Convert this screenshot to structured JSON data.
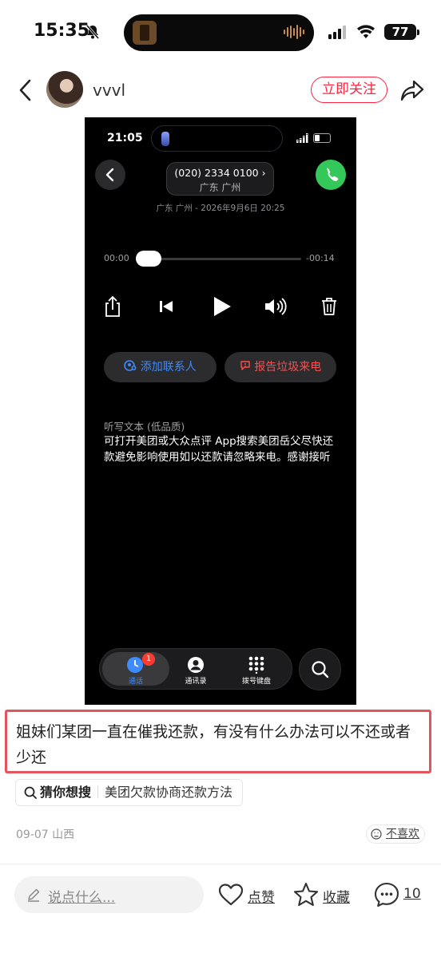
{
  "status_bar": {
    "time": "15:35",
    "battery": "77"
  },
  "header": {
    "username": "vvvl",
    "follow_label": "立即关注"
  },
  "screenshot": {
    "time": "21:05",
    "phone_number": "(020) 2334 0100 ›",
    "location": "广东 广州",
    "date_line": "广东 广州 - 2026年9月6日 20:25",
    "elapsed": "00:00",
    "remaining": "-00:14",
    "add_contact": "添加联系人",
    "report_spam": "报告垃圾来电",
    "transcript_title": "听写文本 (低品质)",
    "transcript_body": "可打开美团或大众点评 App搜索美团岳父尽快还款避免影响使用如以还款请忽略来电。感谢接听",
    "tabs": [
      {
        "label": "通话",
        "badge": "1"
      },
      {
        "label": "通讯录"
      },
      {
        "label": "拨号键盘"
      }
    ],
    "colors": {
      "call_green": "#34c759",
      "accent_blue": "#3d8bfd",
      "report_red": "#ff4d4d"
    }
  },
  "post": {
    "caption": "姐妹们某团一直在催我还款，有没有什么办法可以不还或者少还",
    "search_lead": "猜你想搜",
    "search_suggestion": "美团欠款协商还款方法",
    "date": "09-07",
    "region": "山西",
    "dislike_label": "不喜欢"
  },
  "bottom_bar": {
    "comment_placeholder": "说点什么...",
    "like_label": "点赞",
    "collect_label": "收藏",
    "comment_count": "10"
  },
  "brand_color": "#ff2442"
}
